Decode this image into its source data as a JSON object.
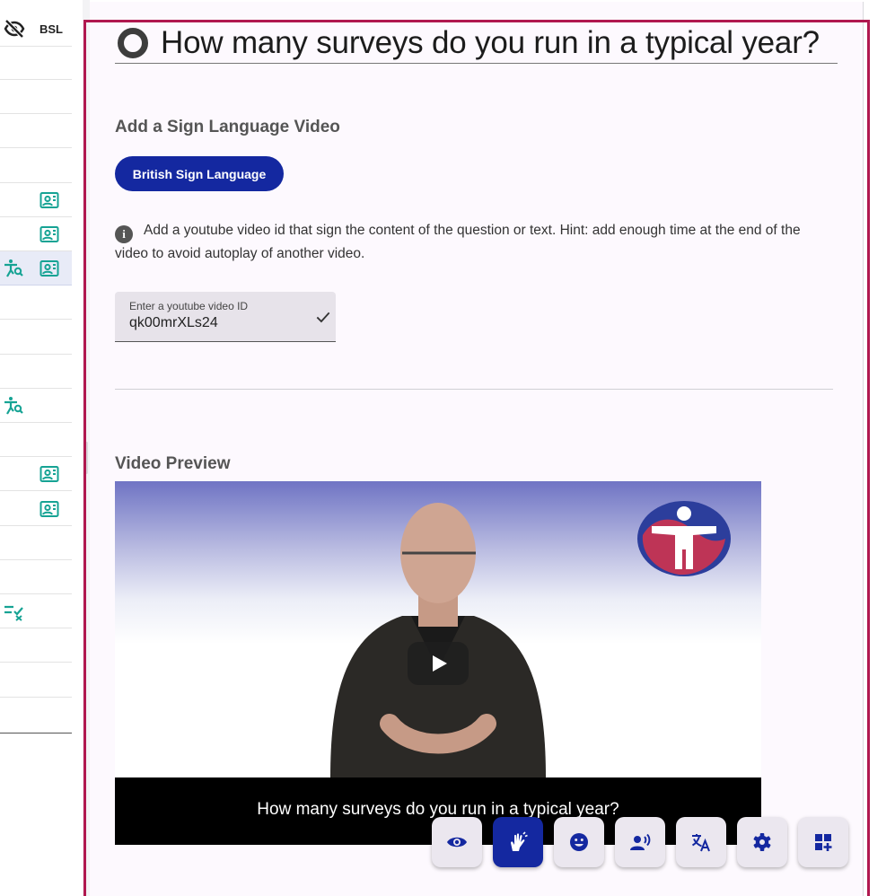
{
  "left_panel": {
    "header_label": "BSL",
    "rows": [
      {
        "icons": []
      },
      {
        "icons": []
      },
      {
        "icons": []
      },
      {
        "icons": []
      },
      {
        "icons": [
          "person-video-icon"
        ]
      },
      {
        "icons": [
          "person-video-icon"
        ]
      },
      {
        "icons": [
          "accessibility-search-icon",
          "person-video-icon"
        ],
        "active": true
      },
      {
        "icons": []
      },
      {
        "icons": []
      },
      {
        "icons": []
      },
      {
        "icons": [
          "accessibility-search-icon"
        ]
      },
      {
        "icons": []
      },
      {
        "icons": [
          "person-video-icon"
        ]
      },
      {
        "icons": [
          "person-video-icon"
        ]
      },
      {
        "icons": []
      },
      {
        "icons": []
      },
      {
        "icons": [
          "checklist-icon"
        ]
      },
      {
        "icons": []
      },
      {
        "icons": []
      }
    ]
  },
  "question": {
    "text": "How many surveys do you run in a typical year?"
  },
  "sign_language": {
    "section_title": "Add a Sign Language Video",
    "button_label": "British Sign Language",
    "hint": "Add a youtube video id that sign the content of the question or text. Hint: add enough time at the end of the video to avoid autoplay of another video.",
    "input_label": "Enter a youtube video ID",
    "input_value": "qk00mrXLs24"
  },
  "preview": {
    "section_title": "Video Preview",
    "caption": "How many surveys do you run in a typical year?"
  },
  "toolbar": {
    "buttons": [
      {
        "icon": "eye-icon",
        "active": false
      },
      {
        "icon": "sign-language-icon",
        "active": true
      },
      {
        "icon": "emoji-icon",
        "active": false
      },
      {
        "icon": "voice-icon",
        "active": false
      },
      {
        "icon": "translate-icon",
        "active": false
      },
      {
        "icon": "settings-gear-icon",
        "active": false
      },
      {
        "icon": "add-widget-icon",
        "active": false
      }
    ]
  },
  "colors": {
    "accent": "#1428a0",
    "frame": "#b0184f",
    "teal": "#16a394",
    "panel_bg": "#fdf9fe"
  }
}
